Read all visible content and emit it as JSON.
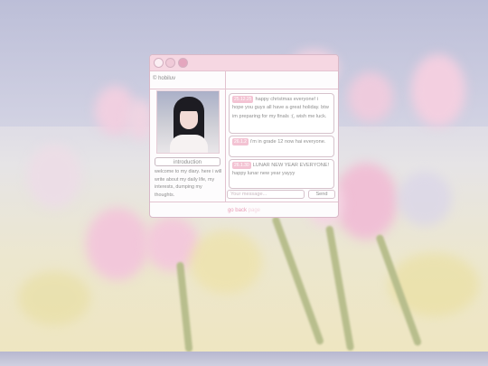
{
  "window": {
    "brand": "© hobiluv",
    "intro_button": "introduction",
    "intro_text": "welcome to my diary. here i will write about my daily life, my interests, dumping my thoughts.",
    "messages": [
      {
        "stamp": "25.12.25",
        "text": "happy christmas everyone! i hope you guys all have a great holiday. btw im preparing for my finals :(, wish me luck."
      },
      {
        "stamp": "26.1.2",
        "text": "i'm in grade 12 now hai everyone."
      },
      {
        "stamp": "26.1.30",
        "text": "LUNAR NEW YEAR EVERYONE! happy lunar new year yayyy"
      }
    ],
    "message_placeholder": "Your message...",
    "send_label": "Send",
    "go_back": "go back",
    "go_back_faded": "page"
  },
  "colors": {
    "accent": "#f3c3d3",
    "titlebar": "#f6d7e2",
    "border": "#d9b9c8",
    "link": "#e89bb5"
  }
}
